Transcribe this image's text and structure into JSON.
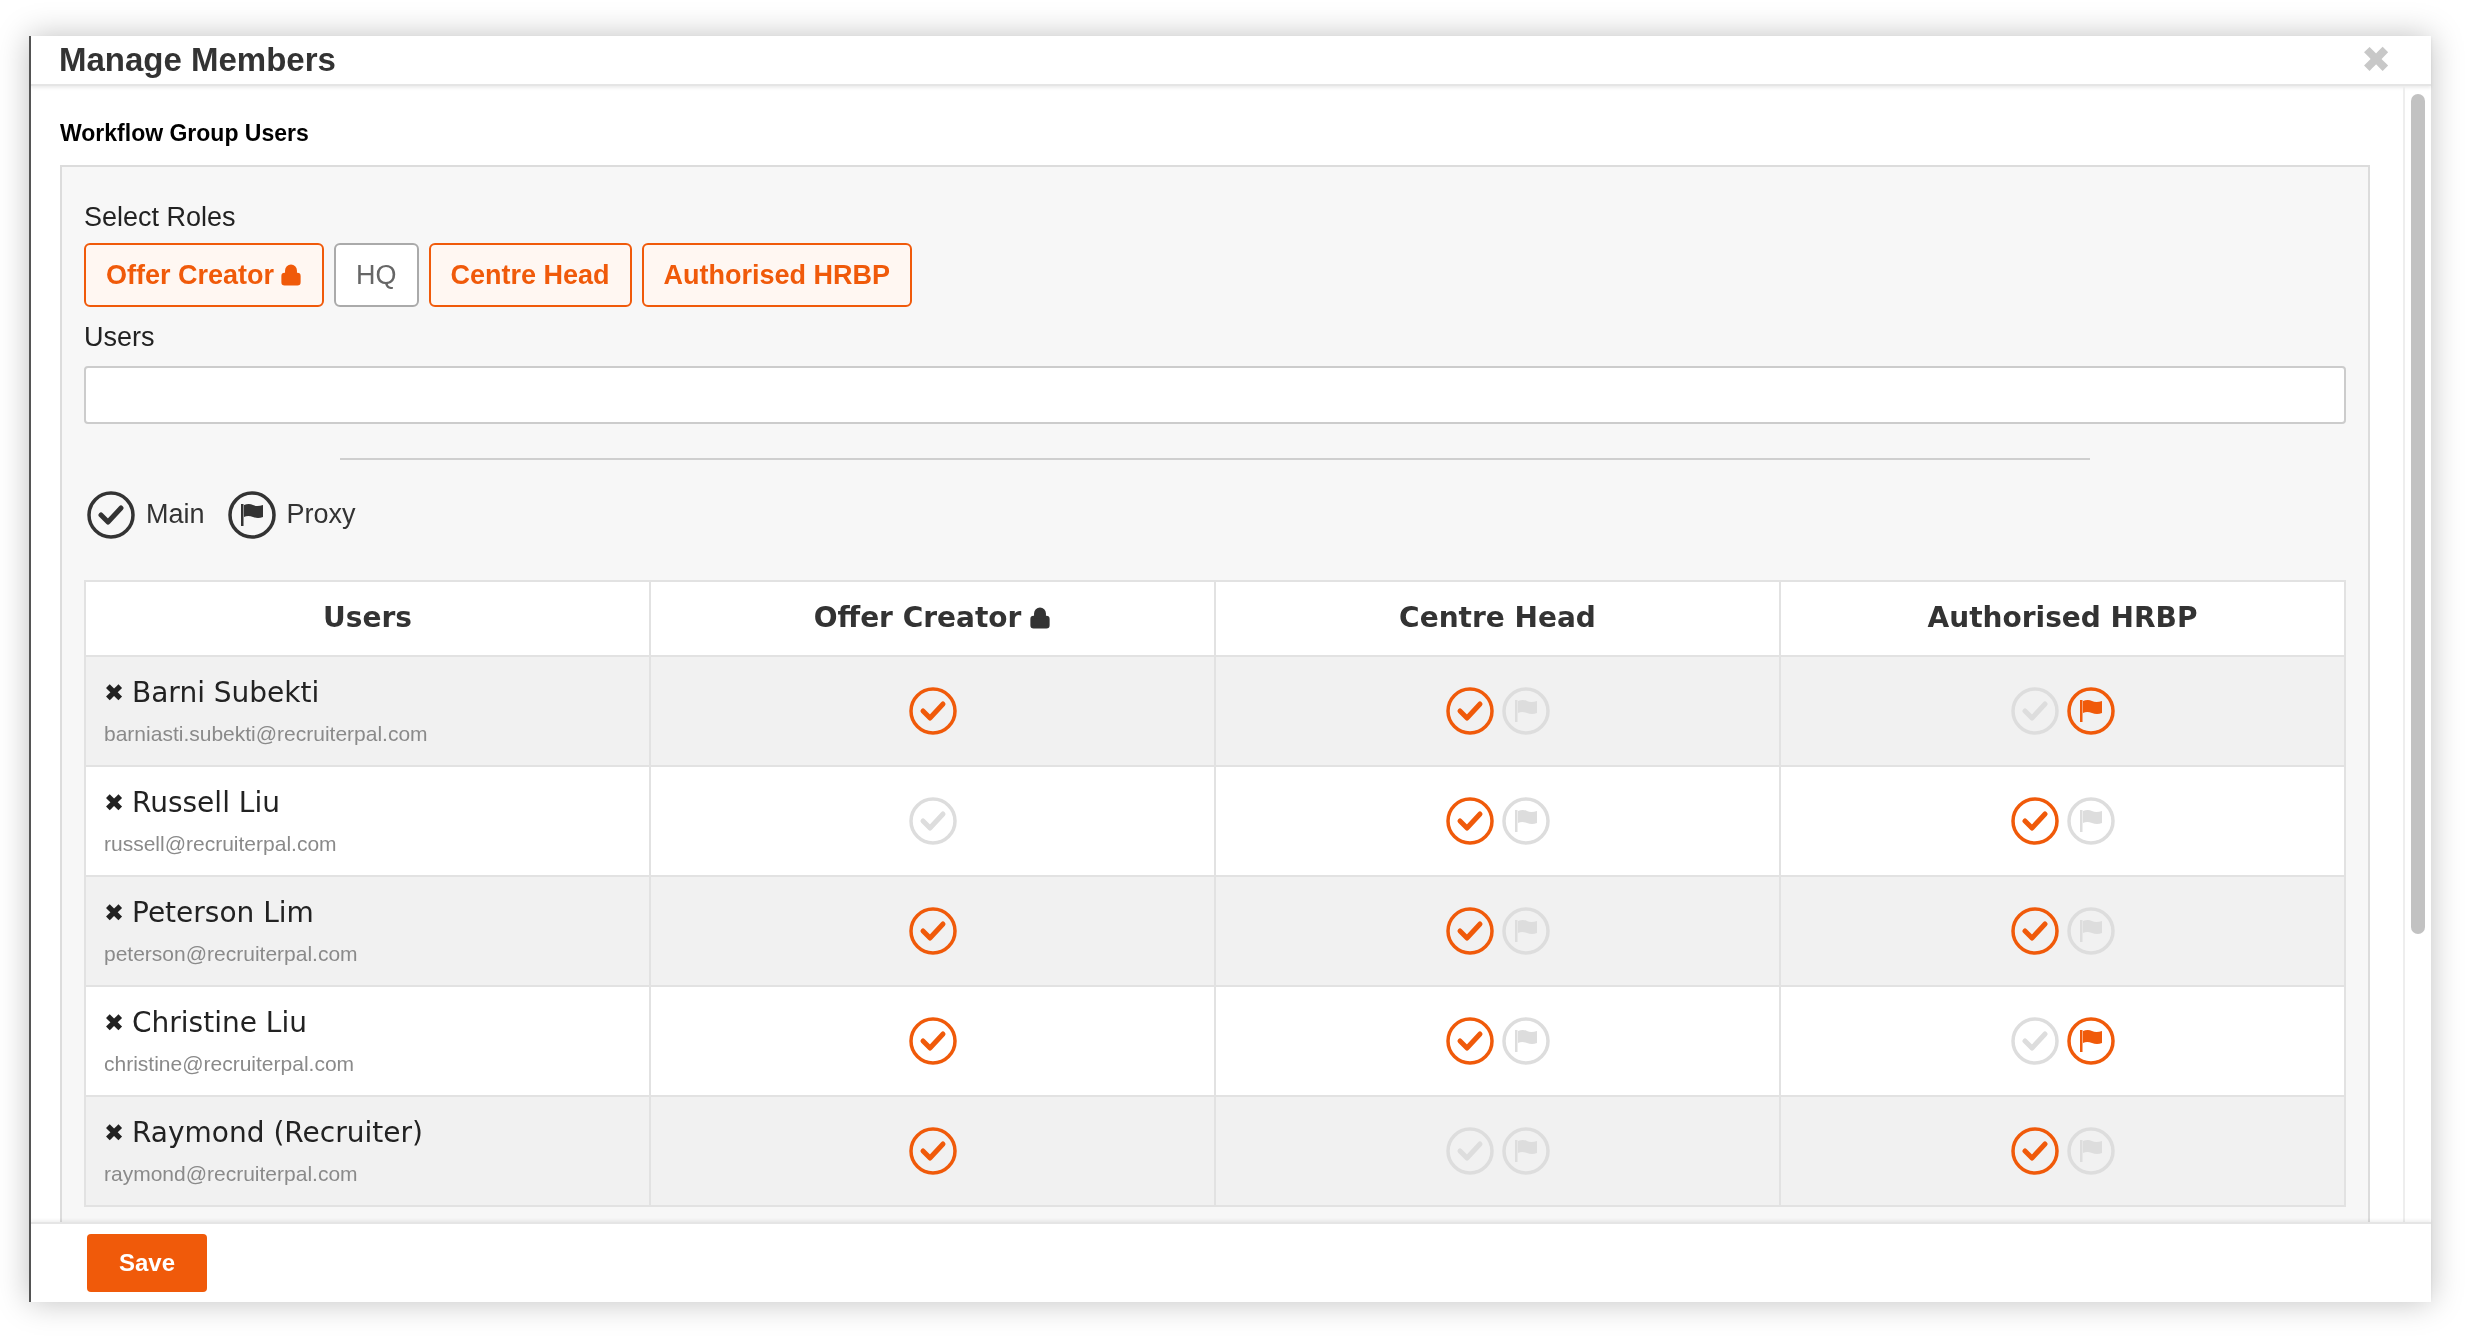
{
  "dialog": {
    "title": "Manage Members",
    "close_label": "✖"
  },
  "section_title": "Workflow Group Users",
  "roles_label": "Select Roles",
  "roles": [
    {
      "label": "Offer Creator",
      "locked": true,
      "selected": true
    },
    {
      "label": "HQ",
      "locked": false,
      "selected": false
    },
    {
      "label": "Centre Head",
      "locked": false,
      "selected": true
    },
    {
      "label": "Authorised HRBP",
      "locked": false,
      "selected": true
    }
  ],
  "users_label": "Users",
  "legend": [
    {
      "kind": "main",
      "label": "Main"
    },
    {
      "kind": "proxy",
      "label": "Proxy"
    }
  ],
  "table": {
    "columns": [
      {
        "label": "Users",
        "locked": false
      },
      {
        "label": "Offer Creator",
        "locked": true
      },
      {
        "label": "Centre Head",
        "locked": false
      },
      {
        "label": "Authorised HRBP",
        "locked": false
      }
    ],
    "rows": [
      {
        "name": "Barni Subekti",
        "email": "barniasti.subekti@recruiterpal.com",
        "cells": [
          {
            "main": true
          },
          {
            "main": true,
            "proxy": false
          },
          {
            "main": false,
            "proxy": true
          }
        ]
      },
      {
        "name": "Russell Liu",
        "email": "russell@recruiterpal.com",
        "cells": [
          {
            "main": false
          },
          {
            "main": true,
            "proxy": false
          },
          {
            "main": true,
            "proxy": false
          }
        ]
      },
      {
        "name": "Peterson Lim",
        "email": "peterson@recruiterpal.com",
        "cells": [
          {
            "main": true
          },
          {
            "main": true,
            "proxy": false
          },
          {
            "main": true,
            "proxy": false
          }
        ]
      },
      {
        "name": "Christine Liu",
        "email": "christine@recruiterpal.com",
        "cells": [
          {
            "main": true
          },
          {
            "main": true,
            "proxy": false
          },
          {
            "main": false,
            "proxy": true
          }
        ]
      },
      {
        "name": "Raymond (Recruiter)",
        "email": "raymond@recruiterpal.com",
        "cells": [
          {
            "main": true
          },
          {
            "main": false,
            "proxy": false
          },
          {
            "main": true,
            "proxy": false
          }
        ]
      }
    ]
  },
  "remove_label": "✖",
  "save_label": "Save"
}
